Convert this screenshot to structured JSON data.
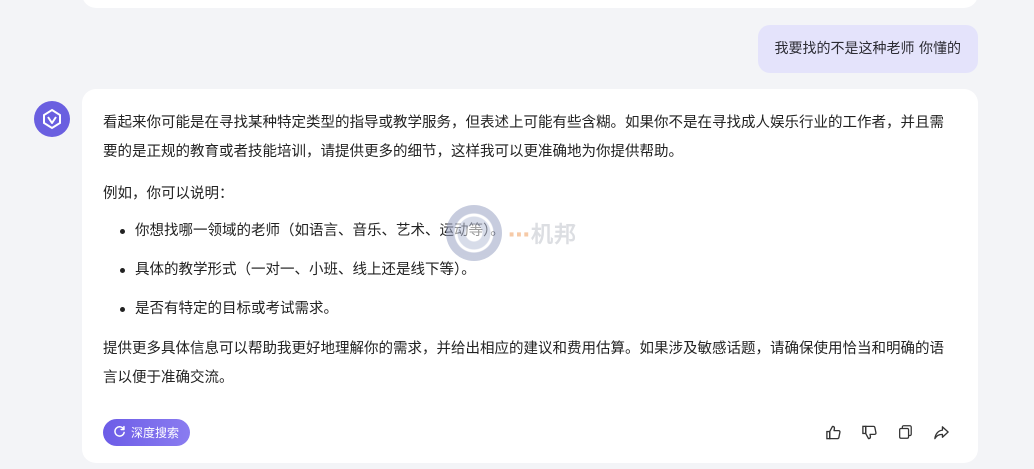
{
  "user_message": "我要找的不是这种老师 你懂的",
  "response": {
    "paragraph_1": "看起来你可能是在寻找某种特定类型的指导或教学服务，但表述上可能有些含糊。如果你不是在寻找成人娱乐行业的工作者，并且需要的是正规的教育或者技能培训，请提供更多的细节，这样我可以更准确地为你提供帮助。",
    "paragraph_2": "例如，你可以说明：",
    "bullets": [
      "你想找哪一领域的老师（如语言、音乐、艺术、运动等）。",
      "具体的教学形式（一对一、小班、线上还是线下等）。",
      "是否有特定的目标或考试需求。"
    ],
    "paragraph_3": "提供更多具体信息可以帮助我更好地理解你的需求，并给出相应的建议和费用估算。如果涉及敏感话题，请确保使用恰当和明确的语言以便于准确交流。"
  },
  "deep_search_label": "深度搜索",
  "watermark": {
    "first_char": "⋯",
    "rest": "机邦"
  },
  "icons": {
    "avatar": "assistant-logo-icon",
    "deep_search": "refresh-search-icon",
    "like": "thumbs-up-icon",
    "dislike": "thumbs-down-icon",
    "copy": "copy-icon",
    "share": "share-icon"
  },
  "colors": {
    "accent": "#6c5ce7",
    "user_bubble": "#e4e3fb",
    "background": "#f3f4f7"
  }
}
